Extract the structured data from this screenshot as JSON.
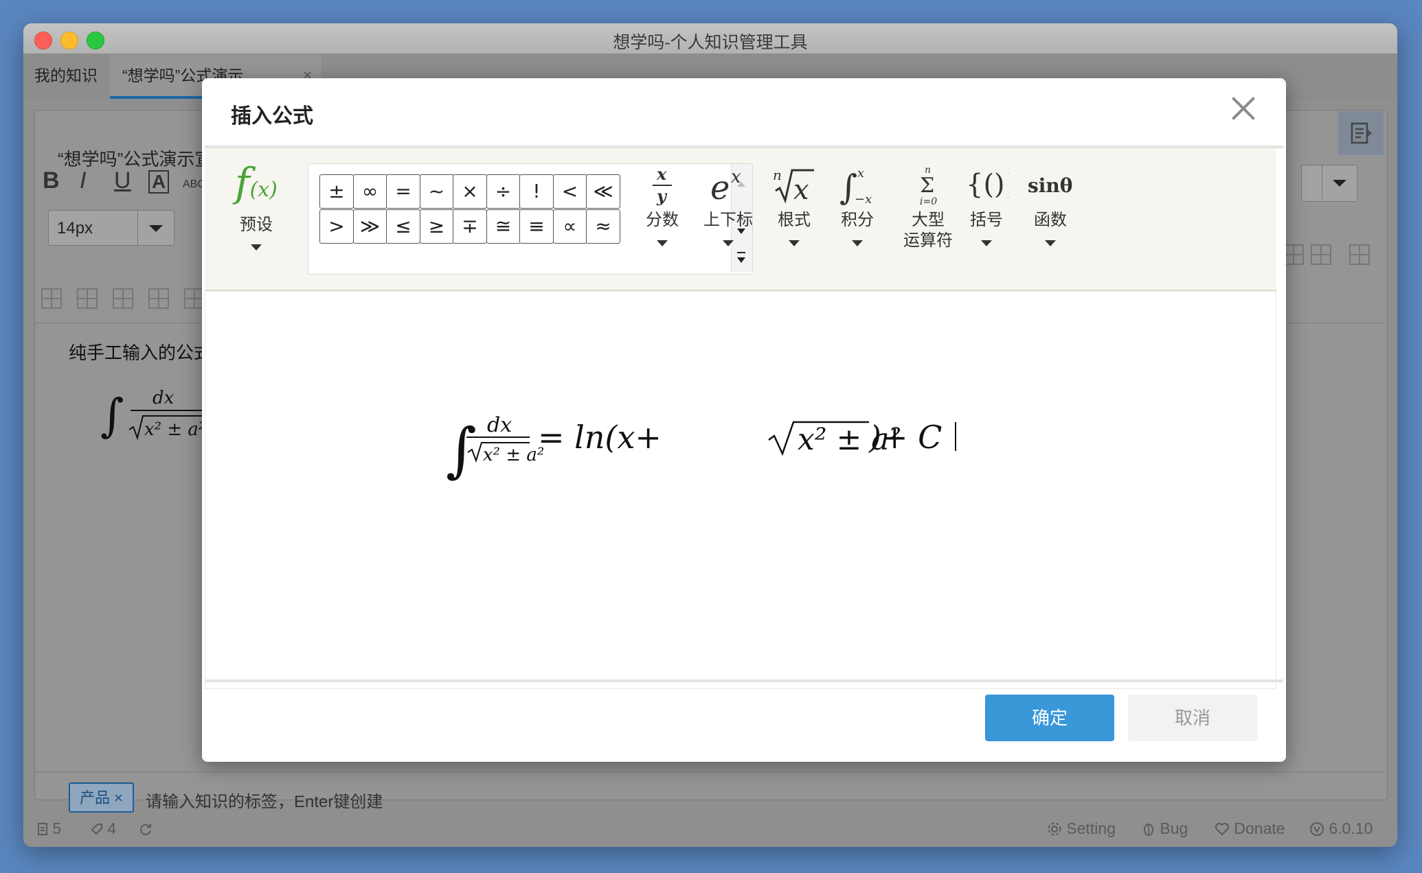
{
  "window": {
    "title": "想学吗-个人知识管理工具"
  },
  "tabs": [
    {
      "label": "我的知识"
    },
    {
      "label": "“想学吗”公式演示",
      "close": "×"
    }
  ],
  "document": {
    "title": "“想学吗”公式演示宣",
    "content_text": "纯手工输入的公式",
    "font_size": "14px"
  },
  "toolbar_letters": {
    "bold": "B",
    "italic": "I",
    "underline": "U",
    "font_color": "A",
    "strike": "ABC"
  },
  "tags": {
    "tag": "产品 ×",
    "input_placeholder": "请输入知识的标签，Enter键创建"
  },
  "status": {
    "docs": "5",
    "tags": "4",
    "setting": "Setting",
    "bug": "Bug",
    "donate": "Donate",
    "version": "6.0.10"
  },
  "modal": {
    "title": "插入公式",
    "preset_label": "预设",
    "symbols_row1": [
      "±",
      "∞",
      "=",
      "~",
      "×",
      "÷",
      "!",
      "<",
      "≪"
    ],
    "symbols_row2": [
      ">",
      "≫",
      "≤",
      "≥",
      "∓",
      "≅",
      "≡",
      "∝",
      "≈"
    ],
    "categories": [
      {
        "label": "分数"
      },
      {
        "label": "上下标"
      },
      {
        "label": "根式"
      },
      {
        "label": "积分"
      },
      {
        "label": "大型\n运算符"
      },
      {
        "label": "括号"
      },
      {
        "label": "函数"
      }
    ],
    "formula": {
      "num": "dx",
      "eq": "= ln(x+",
      "rad": "x² ± a²",
      "tail": ")+ C"
    },
    "confirm": "确定",
    "cancel": "取消"
  }
}
